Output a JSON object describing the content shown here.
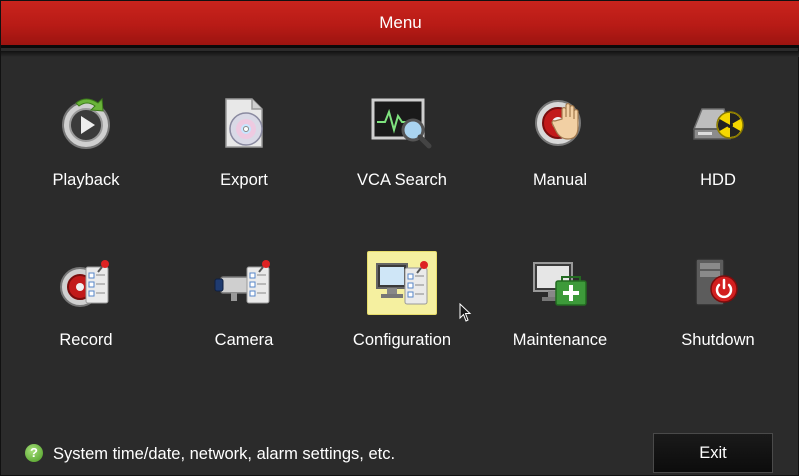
{
  "window": {
    "title": "Menu"
  },
  "menu": {
    "items": [
      {
        "label": "Playback",
        "icon": "playback-icon",
        "selected": false
      },
      {
        "label": "Export",
        "icon": "export-icon",
        "selected": false
      },
      {
        "label": "VCA Search",
        "icon": "vca-search-icon",
        "selected": false
      },
      {
        "label": "Manual",
        "icon": "manual-icon",
        "selected": false
      },
      {
        "label": "HDD",
        "icon": "hdd-icon",
        "selected": false
      },
      {
        "label": "Record",
        "icon": "record-icon",
        "selected": false
      },
      {
        "label": "Camera",
        "icon": "camera-icon",
        "selected": false
      },
      {
        "label": "Configuration",
        "icon": "configuration-icon",
        "selected": true
      },
      {
        "label": "Maintenance",
        "icon": "maintenance-icon",
        "selected": false
      },
      {
        "label": "Shutdown",
        "icon": "shutdown-icon",
        "selected": false
      }
    ]
  },
  "status": {
    "hint": "System time/date, network, alarm settings, etc.",
    "icon": "help-icon"
  },
  "buttons": {
    "exit_label": "Exit"
  },
  "colors": {
    "titlebar": "#b81b16",
    "background": "#2b2b2b",
    "selected_tile": "#f5f0a0"
  }
}
